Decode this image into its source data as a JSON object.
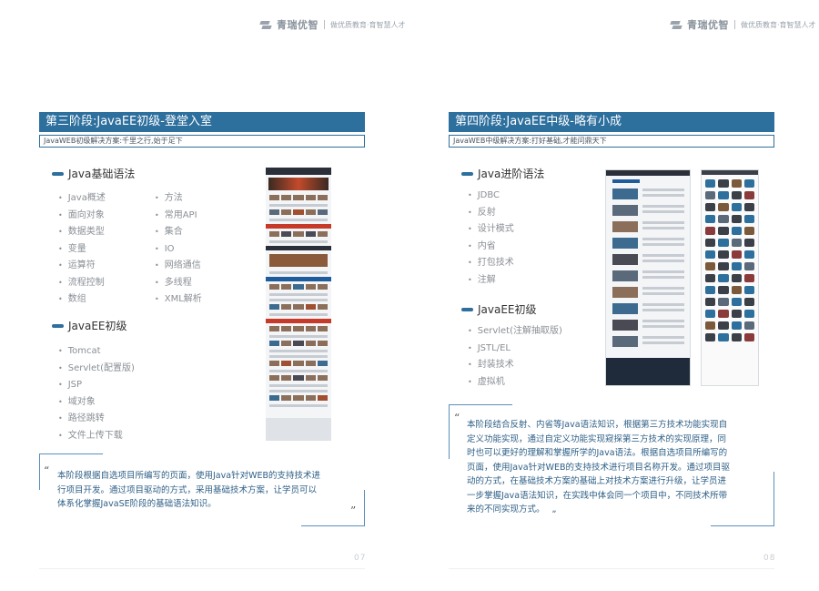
{
  "brand": {
    "name": "青瑞优智",
    "tagline": "做优质教育·育智慧人才"
  },
  "left_page": {
    "stage_title": "第三阶段:JavaEE初级-登堂入室",
    "stage_subtitle": "JavaWEB初级解决方案:千里之行,始于足下",
    "section1": {
      "title": "Java基础语法",
      "col1": [
        "Java概述",
        "面向对象",
        "数据类型",
        "变量",
        "运算符",
        "流程控制",
        "数组"
      ],
      "col2": [
        "方法",
        "常用API",
        "集合",
        "IO",
        "网络通信",
        "多线程",
        "XML解析"
      ]
    },
    "section2": {
      "title": "JavaEE初级",
      "items": [
        "Tomcat",
        "Servlet(配置版)",
        "JSP",
        "域对象",
        "路径跳转",
        "文件上传下载"
      ]
    },
    "quote_open": "“",
    "quote_close": "”",
    "quote_lines": [
      "本阶段根据自选项目所编写的页面，使用Java针对WEB的支持技术进",
      "行项目开发。通过项目驱动的方式，采用基础技术方案，让学员可以",
      "体系化掌握JavaSE阶段的基础语法知识。"
    ],
    "page_number": "07"
  },
  "right_page": {
    "stage_title": "第四阶段:JavaEE中级-略有小成",
    "stage_subtitle": "JavaWEB中级解决方案:打好基础,才能问鼎天下",
    "section1": {
      "title": "Java进阶语法",
      "items": [
        "JDBC",
        "反射",
        "设计模式",
        "内省",
        "打包技术",
        "注解"
      ]
    },
    "section2": {
      "title": "JavaEE初级",
      "items": [
        "Servlet(注解抽取版)",
        "JSTL/EL",
        "封装技术",
        "虚拟机"
      ]
    },
    "quote_open": "“",
    "quote_close": "„",
    "quote_lines": [
      "本阶段结合反射、内省等Java语法知识，根据第三方技术功能实现自",
      "定义功能实现，通过自定义功能实现窥探第三方技术的实现原理，同",
      "时也可以更好的理解和掌握所学的Java语法。根据自选项目所编写的",
      "页面，使用Java针对WEB的支持技术进行项目名称开发。通过项目驱",
      "动的方式，在基础技术方案的基础上对技术方案进行升级，让学员进",
      "一步掌握Java语法知识，在实践中体会同一个项目中，不同技术所带",
      "来的不同实现方式。"
    ],
    "page_number": "08"
  },
  "colors": {
    "accent": "#2d6f9d",
    "quote_text": "#2e5f86",
    "muted_text": "#8a8f95"
  }
}
